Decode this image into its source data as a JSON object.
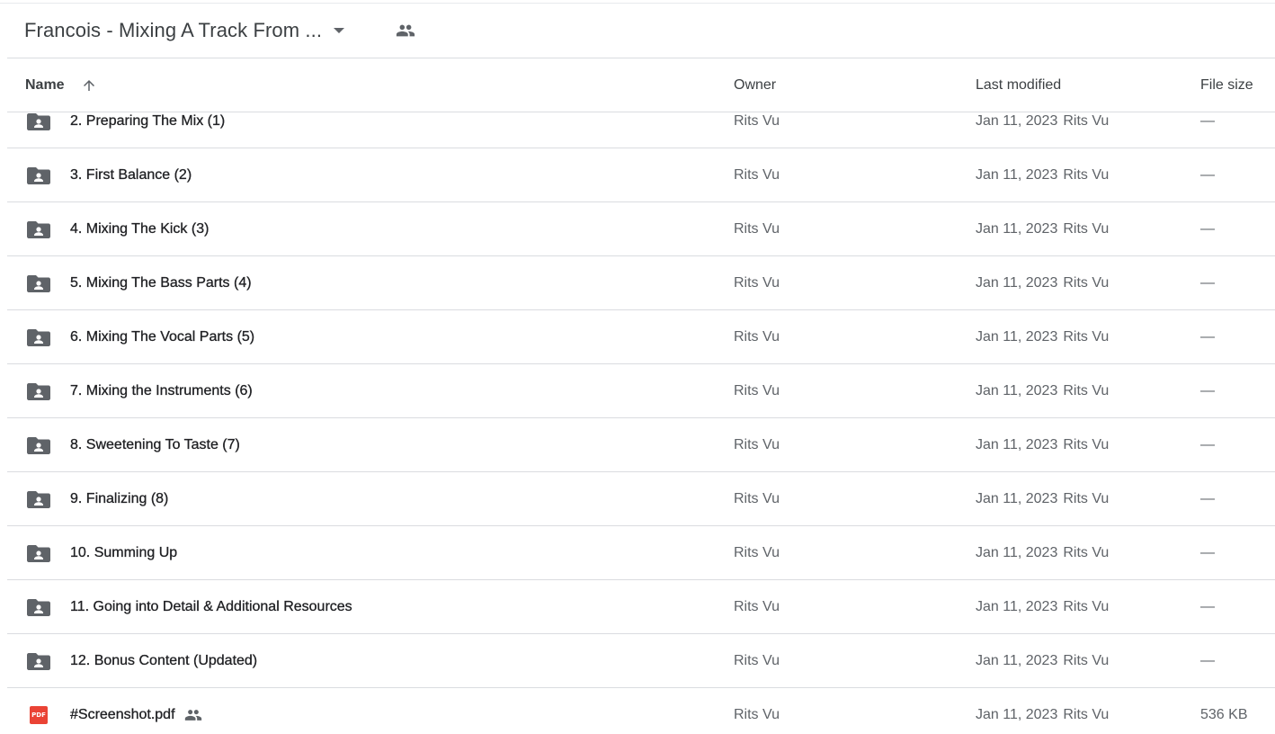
{
  "header": {
    "folder_title": "Francois - Mixing A Track From ...",
    "caret_icon": "arrow-drop-down-icon",
    "shared_icon": "people-icon"
  },
  "columns": {
    "name": "Name",
    "owner": "Owner",
    "last_modified": "Last modified",
    "file_size": "File size",
    "sort_icon": "arrow-upward-icon"
  },
  "rows": [
    {
      "name": "2. Preparing The Mix (1)",
      "owner": "Rits Vu",
      "modified": "Jan 11, 2023",
      "modified_by": "Rits Vu",
      "size": "—",
      "icon": "shared-folder-icon"
    },
    {
      "name": "3. First Balance (2)",
      "owner": "Rits Vu",
      "modified": "Jan 11, 2023",
      "modified_by": "Rits Vu",
      "size": "—",
      "icon": "shared-folder-icon"
    },
    {
      "name": "4. Mixing The Kick (3)",
      "owner": "Rits Vu",
      "modified": "Jan 11, 2023",
      "modified_by": "Rits Vu",
      "size": "—",
      "icon": "shared-folder-icon"
    },
    {
      "name": "5. Mixing The Bass Parts (4)",
      "owner": "Rits Vu",
      "modified": "Jan 11, 2023",
      "modified_by": "Rits Vu",
      "size": "—",
      "icon": "shared-folder-icon"
    },
    {
      "name": "6. Mixing The Vocal Parts (5)",
      "owner": "Rits Vu",
      "modified": "Jan 11, 2023",
      "modified_by": "Rits Vu",
      "size": "—",
      "icon": "shared-folder-icon"
    },
    {
      "name": "7. Mixing the Instruments (6)",
      "owner": "Rits Vu",
      "modified": "Jan 11, 2023",
      "modified_by": "Rits Vu",
      "size": "—",
      "icon": "shared-folder-icon"
    },
    {
      "name": "8. Sweetening To Taste (7)",
      "owner": "Rits Vu",
      "modified": "Jan 11, 2023",
      "modified_by": "Rits Vu",
      "size": "—",
      "icon": "shared-folder-icon"
    },
    {
      "name": "9. Finalizing (8)",
      "owner": "Rits Vu",
      "modified": "Jan 11, 2023",
      "modified_by": "Rits Vu",
      "size": "—",
      "icon": "shared-folder-icon"
    },
    {
      "name": "10. Summing Up",
      "owner": "Rits Vu",
      "modified": "Jan 11, 2023",
      "modified_by": "Rits Vu",
      "size": "—",
      "icon": "shared-folder-icon"
    },
    {
      "name": "11. Going into Detail & Additional Resources",
      "owner": "Rits Vu",
      "modified": "Jan 11, 2023",
      "modified_by": "Rits Vu",
      "size": "—",
      "icon": "shared-folder-icon"
    },
    {
      "name": "12. Bonus Content (Updated)",
      "owner": "Rits Vu",
      "modified": "Jan 11, 2023",
      "modified_by": "Rits Vu",
      "size": "—",
      "icon": "shared-folder-icon"
    },
    {
      "name": "#Screenshot.pdf",
      "owner": "Rits Vu",
      "modified": "Jan 11, 2023",
      "modified_by": "Rits Vu",
      "size": "536 KB",
      "icon": "pdf-file-icon",
      "shared": true,
      "badge_text": "PDF"
    }
  ],
  "colors": {
    "text": "#3c4043",
    "secondary_text": "#5f6368",
    "icon": "#5f6368",
    "divider": "#dadce0",
    "pdf": "#ea4335"
  }
}
